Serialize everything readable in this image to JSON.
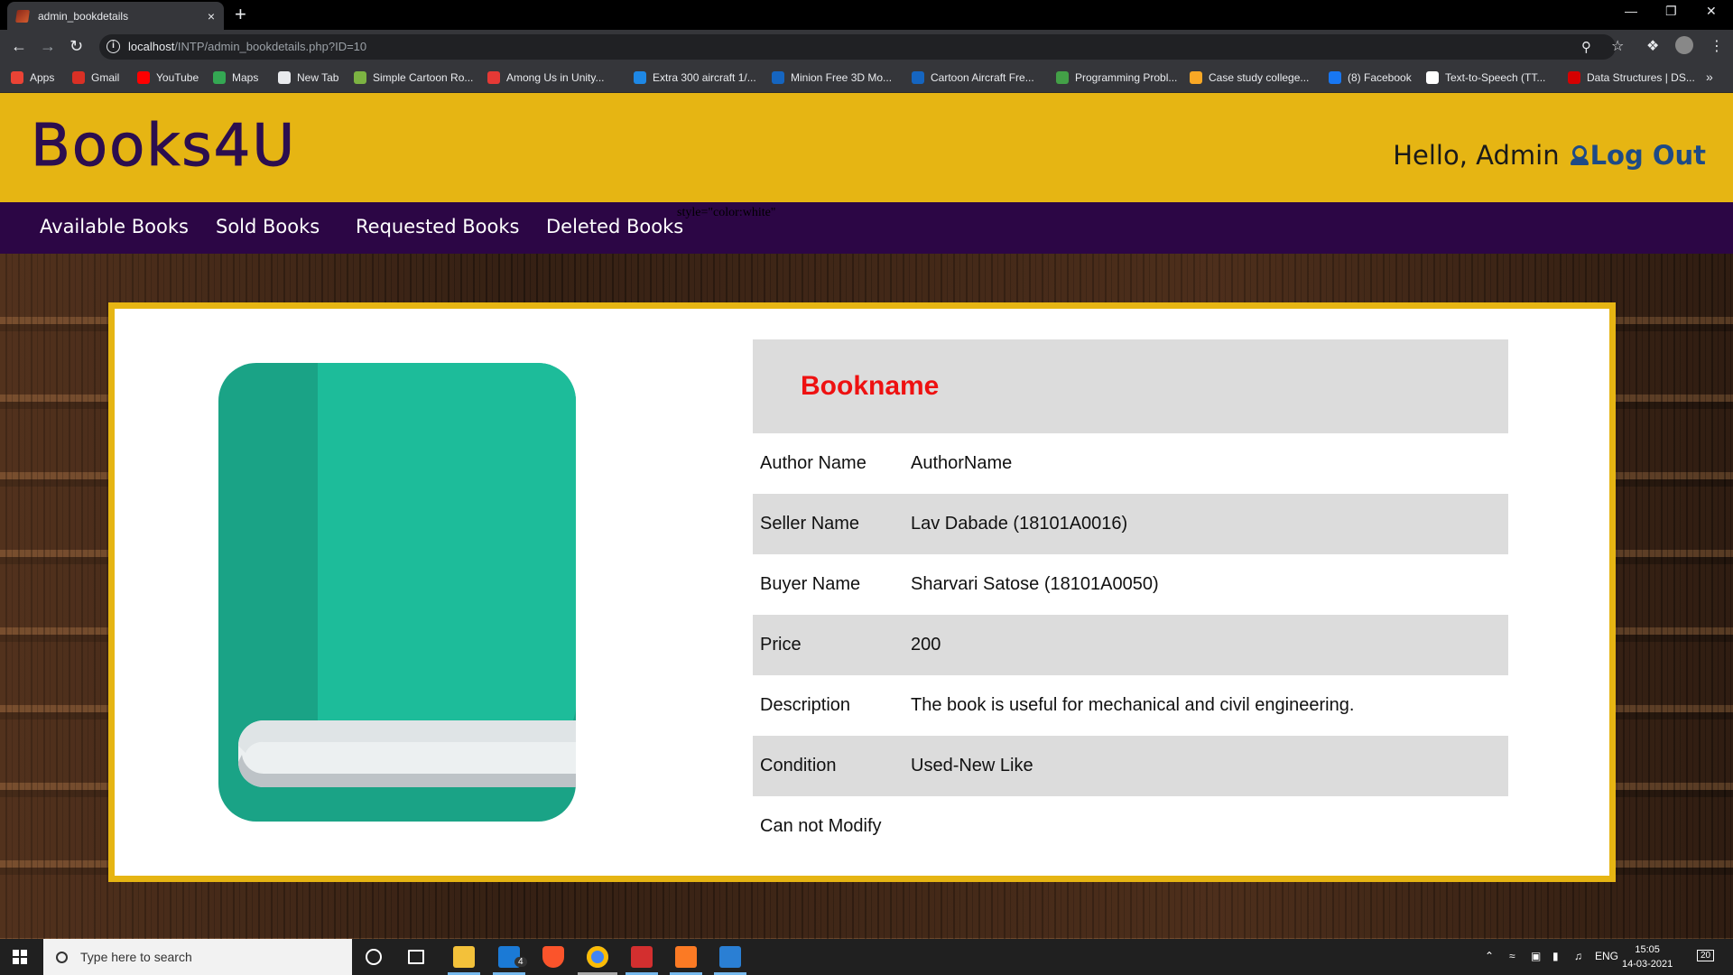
{
  "browser": {
    "tab_title": "admin_bookdetails",
    "tab_close": "×",
    "new_tab": "+",
    "url_host": "localhost",
    "url_path": "/INTP/admin_bookdetails.php?ID=10",
    "bookmarks": [
      {
        "label": "Apps",
        "color": "#ea4335"
      },
      {
        "label": "Gmail",
        "color": "#d93025"
      },
      {
        "label": "YouTube",
        "color": "#ff0000"
      },
      {
        "label": "Maps",
        "color": "#34a853"
      },
      {
        "label": "New Tab",
        "color": "#e8eaed"
      },
      {
        "label": "Simple Cartoon Ro...",
        "color": "#7cb342"
      },
      {
        "label": "Among Us in Unity...",
        "color": "#e53935"
      },
      {
        "label": "Extra 300 aircraft 1/...",
        "color": "#1e88e5"
      },
      {
        "label": "Minion Free 3D Mo...",
        "color": "#1565c0"
      },
      {
        "label": "Cartoon Aircraft Fre...",
        "color": "#1565c0"
      },
      {
        "label": "Programming Probl...",
        "color": "#43a047"
      },
      {
        "label": "Case study college...",
        "color": "#f9a825"
      },
      {
        "label": "(8) Facebook",
        "color": "#1877f2"
      },
      {
        "label": "Text-to-Speech (TT...",
        "color": "#ffffff"
      },
      {
        "label": "Data Structures | DS...",
        "color": "#d50000"
      }
    ],
    "bookmarks_more": "»"
  },
  "site": {
    "logo": "Books4U",
    "greeting": "Hello, Admin",
    "logout": "Log Out",
    "nav": [
      "Available Books",
      "Sold Books",
      "Requested Books",
      "Deleted Books"
    ],
    "stray_text": "style=\"color:white\""
  },
  "book": {
    "title": "Bookname",
    "fields": [
      {
        "label": "Author Name",
        "value": "AuthorName"
      },
      {
        "label": "Seller Name",
        "value": "Lav Dabade (18101A0016)"
      },
      {
        "label": "Buyer Name",
        "value": "Sharvari Satose (18101A0050)"
      },
      {
        "label": "Price",
        "value": "200"
      },
      {
        "label": "Description",
        "value": "The book is useful for mechanical and civil engineering."
      },
      {
        "label": "Condition",
        "value": "Used-New Like"
      }
    ],
    "footer_note": "Can not Modify"
  },
  "taskbar": {
    "search_placeholder": "Type here to search",
    "mail_badge": "4",
    "lang": "ENG",
    "time": "15:05",
    "date": "14-03-2021",
    "notifications": "20"
  },
  "colors": {
    "header_yellow": "#e6b513",
    "nav_purple": "#2c0645",
    "logo_purple": "#2c0e4f",
    "logout_blue": "#1e4a86",
    "title_red": "#ee1111",
    "row_gray": "#dcdcdc",
    "book_teal": "#1dbc9a"
  }
}
